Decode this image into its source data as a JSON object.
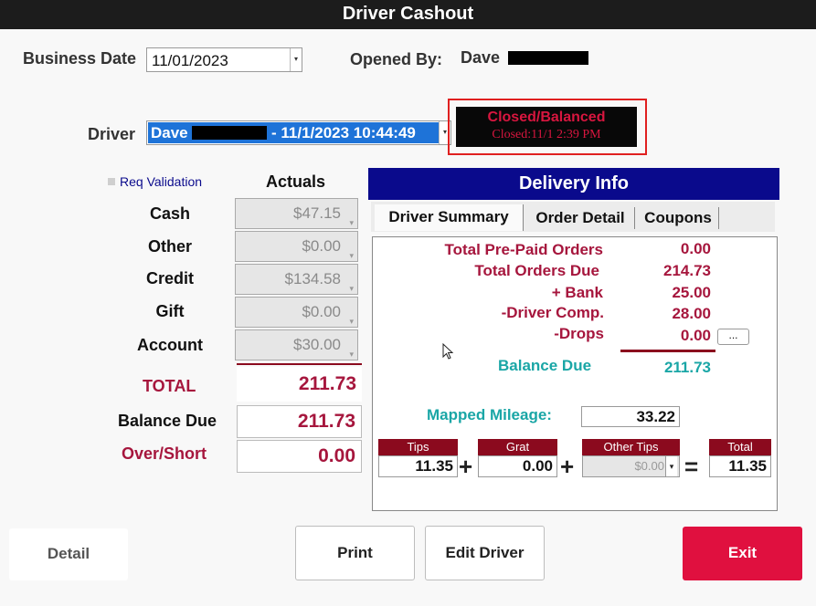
{
  "window": {
    "title": "Driver Cashout"
  },
  "header": {
    "business_date_label": "Business Date",
    "business_date_value": "11/01/2023",
    "opened_by_label": "Opened By:",
    "opened_by_value": "Dave"
  },
  "driver": {
    "label": "Driver",
    "selected_prefix": "Dave",
    "selected_suffix": "- 11/1/2023 10:44:49"
  },
  "status": {
    "title": "Closed/Balanced",
    "closed_text": "Closed:11/1 2:39 PM"
  },
  "actuals": {
    "req_validation_label": "Req Validation",
    "header": "Actuals",
    "rows": [
      {
        "label": "Cash",
        "value": "$47.15"
      },
      {
        "label": "Other",
        "value": "$0.00"
      },
      {
        "label": "Credit",
        "value": "$134.58"
      },
      {
        "label": "Gift",
        "value": "$0.00"
      },
      {
        "label": "Account",
        "value": "$30.00"
      }
    ],
    "total_label": "TOTAL",
    "total_value": "211.73",
    "balance_due_label": "Balance Due",
    "balance_due_value": "211.73",
    "over_short_label": "Over/Short",
    "over_short_value": "0.00"
  },
  "delivery": {
    "title": "Delivery Info",
    "tabs": [
      "Driver Summary",
      "Order Detail",
      "Coupons"
    ],
    "summary": [
      {
        "label": "Total Pre-Paid Orders",
        "value": "0.00"
      },
      {
        "label": "Total Orders Due",
        "value": "214.73"
      },
      {
        "label": "+ Bank",
        "value": "25.00"
      },
      {
        "label": "-Driver Comp.",
        "value": "28.00"
      },
      {
        "label": "-Drops",
        "value": "0.00"
      }
    ],
    "drops_button": "...",
    "balance_due_label": "Balance Due",
    "balance_due_value": "211.73",
    "mileage_label": "Mapped Mileage:",
    "mileage_value": "33.22",
    "tips": {
      "tips_label": "Tips",
      "tips_value": "11.35",
      "grat_label": "Grat",
      "grat_value": "0.00",
      "other_label": "Other Tips",
      "other_value": "$0.00",
      "total_label": "Total",
      "total_value": "11.35",
      "plus": "+",
      "equals": "="
    }
  },
  "buttons": {
    "detail": "Detail",
    "print": "Print",
    "edit_driver": "Edit Driver",
    "exit": "Exit"
  },
  "colors": {
    "maroon": "#a6163d",
    "teal": "#1aa6a6",
    "navy": "#0a0a8c",
    "exit": "#e0103f",
    "highlight": "#1e73d8"
  }
}
